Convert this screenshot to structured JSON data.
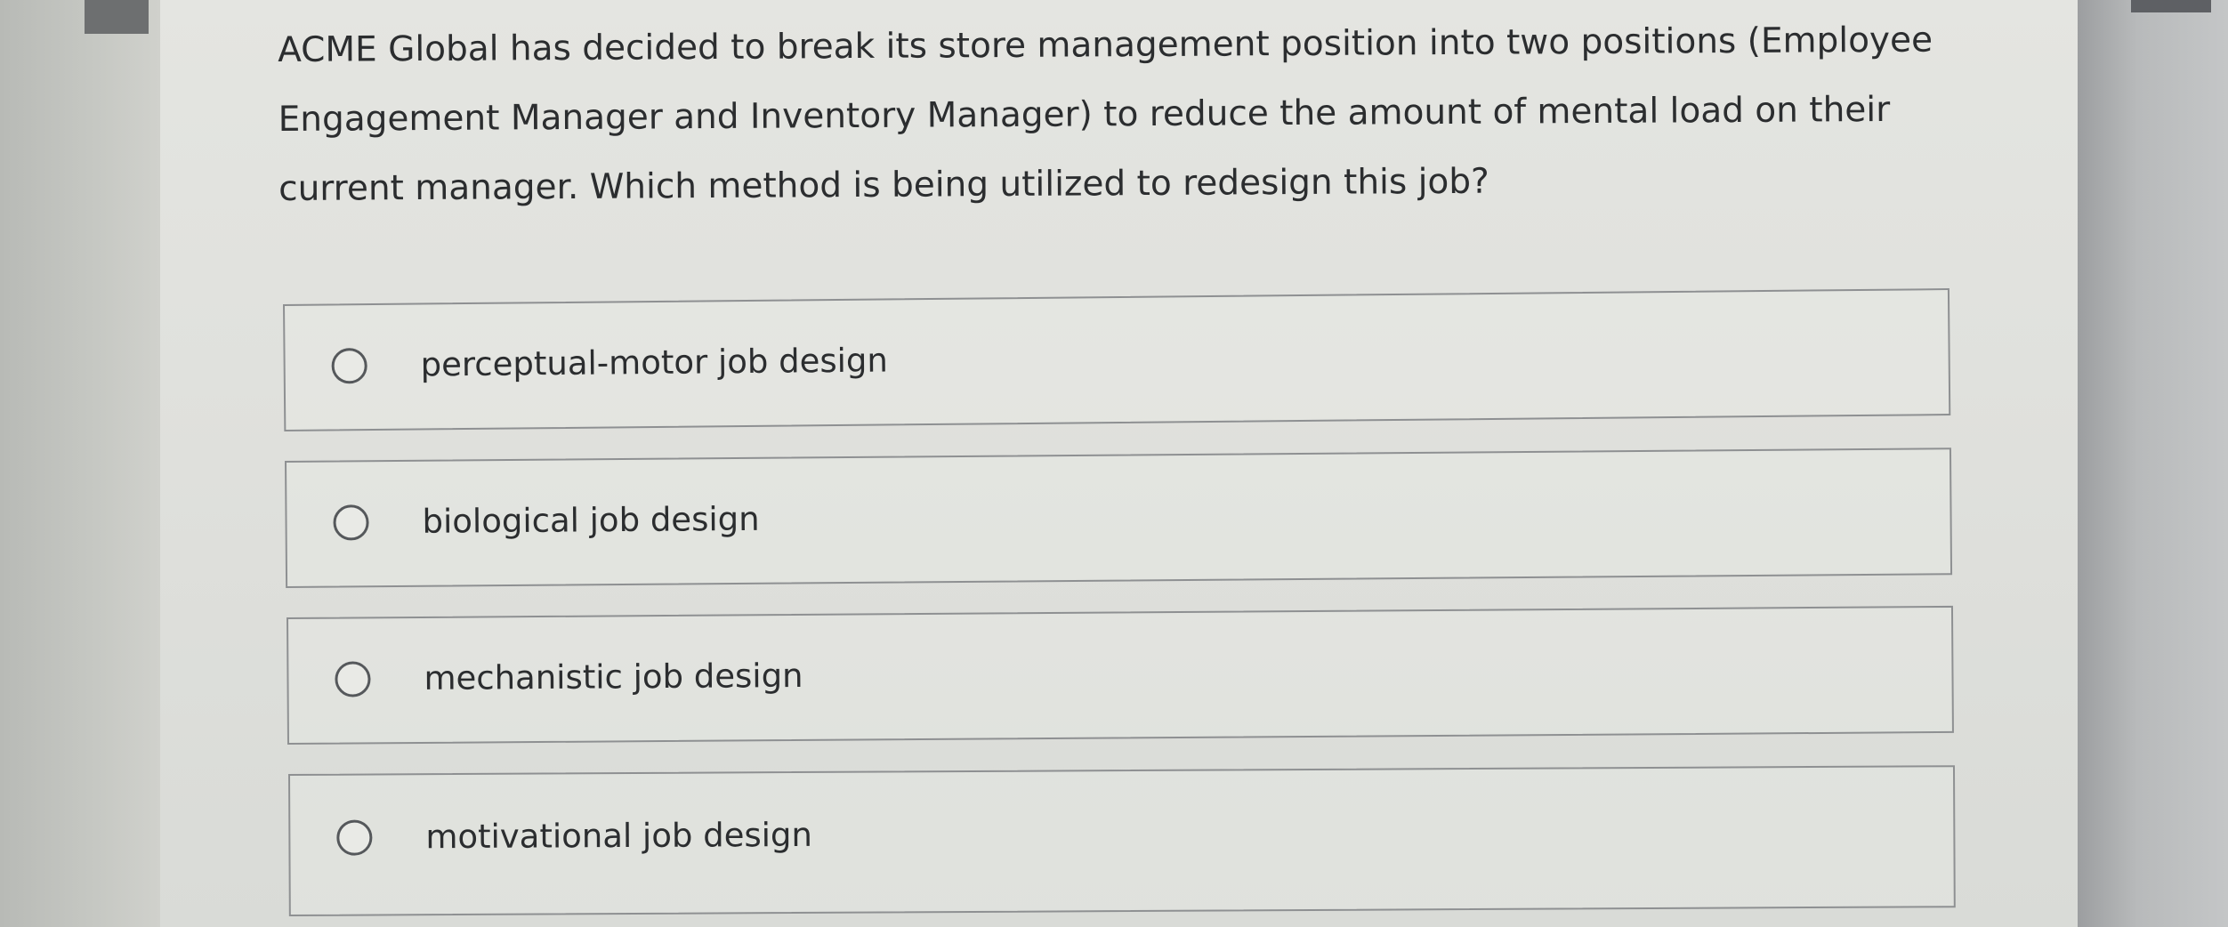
{
  "question": {
    "text": "ACME Global has decided to break its store management position into two positions (Employee Engagement Manager and Inventory Manager) to reduce the amount of mental load on their current manager. Which method is being utilized to redesign this job?"
  },
  "options": [
    {
      "label": "perceptual-motor job design",
      "icon": "radio-unchecked-icon"
    },
    {
      "label": "biological job design",
      "icon": "radio-unchecked-icon"
    },
    {
      "label": "mechanistic job design",
      "icon": "radio-unchecked-icon"
    },
    {
      "label": "motivational job design",
      "icon": "radio-unchecked-icon"
    }
  ]
}
